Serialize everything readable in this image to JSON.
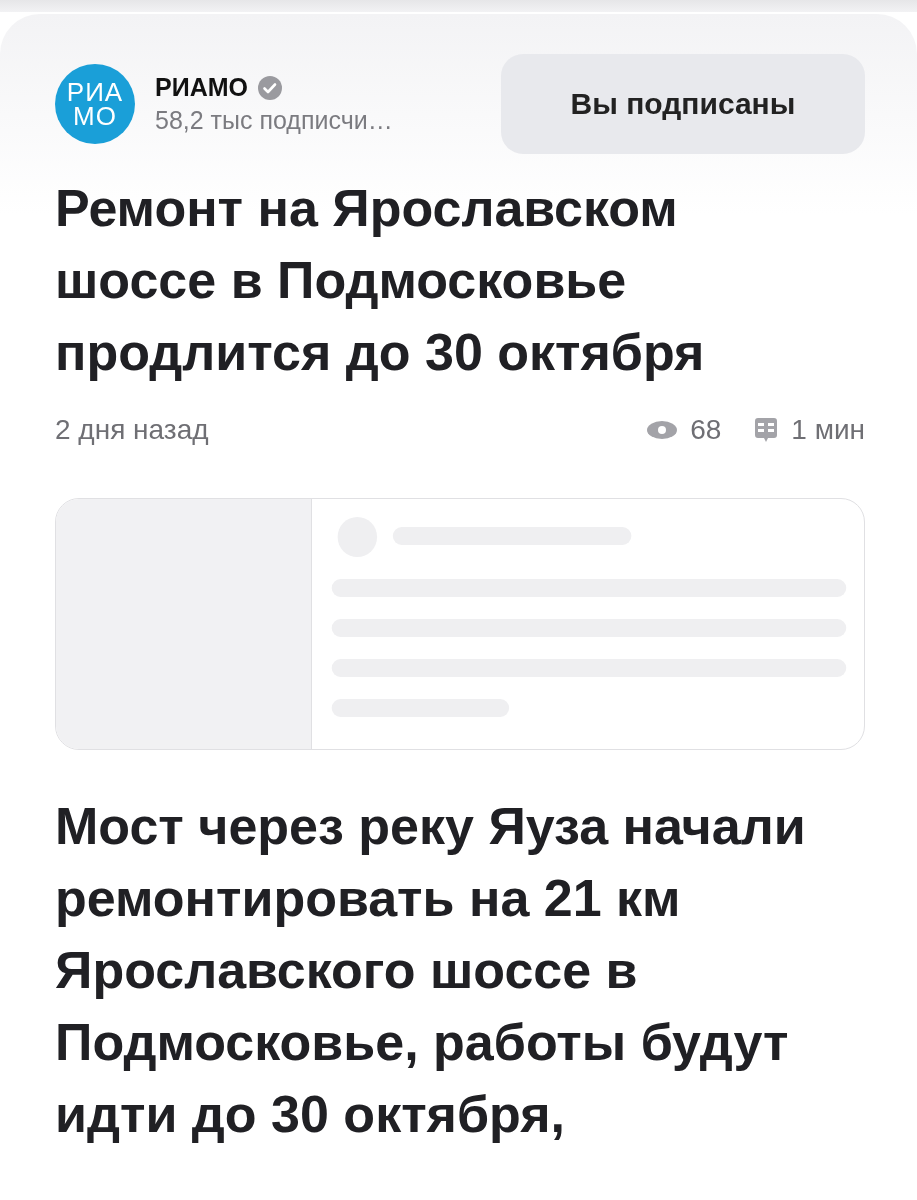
{
  "channel": {
    "logo": [
      "РИА",
      "МО"
    ],
    "name": "РИАМО",
    "verified": true,
    "subscribers": "58,2 тыс подписчи…",
    "subscribe_button": {
      "label": "Вы подписаны",
      "subscribed": true
    }
  },
  "article": {
    "title": "Ремонт на Ярославском шоссе в Подмосковье продлится до 30 октября",
    "date": "2 дня назад",
    "views": "68",
    "read_time": "1 мин",
    "embed": {
      "loading": true
    },
    "lead": "Мост через реку Яуза начали ремонтировать на 21 км Ярославского шоссе в Подмосковье, работы будут идти до 30 октября,"
  }
}
